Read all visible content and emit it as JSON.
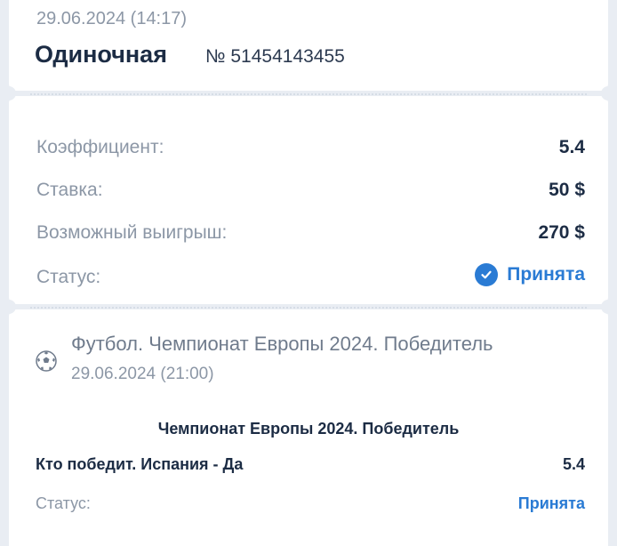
{
  "header": {
    "datetime": "29.06.2024 (14:17)",
    "bet_type": "Одиночная",
    "bet_number": "№ 51454143455"
  },
  "summary": {
    "odds_label": "Коэффициент:",
    "odds_value": "5.4",
    "stake_label": "Ставка:",
    "stake_value": "50 $",
    "win_label": "Возможный выигрыш:",
    "win_value": "270 $",
    "status_label": "Статус:",
    "status_value": "Принята",
    "status_icon": "check-circle-icon"
  },
  "event": {
    "sport_icon": "football-icon",
    "title": "Футбол. Чемпионат Европы 2024. Победитель",
    "datetime": "29.06.2024 (21:00)",
    "market": "Чемпионат Европы 2024. Победитель",
    "outcome": "Кто победит. Испания - Да",
    "outcome_odds": "5.4",
    "status_label": "Статус:",
    "status_value": "Принята"
  },
  "colors": {
    "accent": "#2a7bd4",
    "text_dark": "#1c2c44",
    "text_muted": "#8c97a6",
    "background": "#e9edf3"
  }
}
